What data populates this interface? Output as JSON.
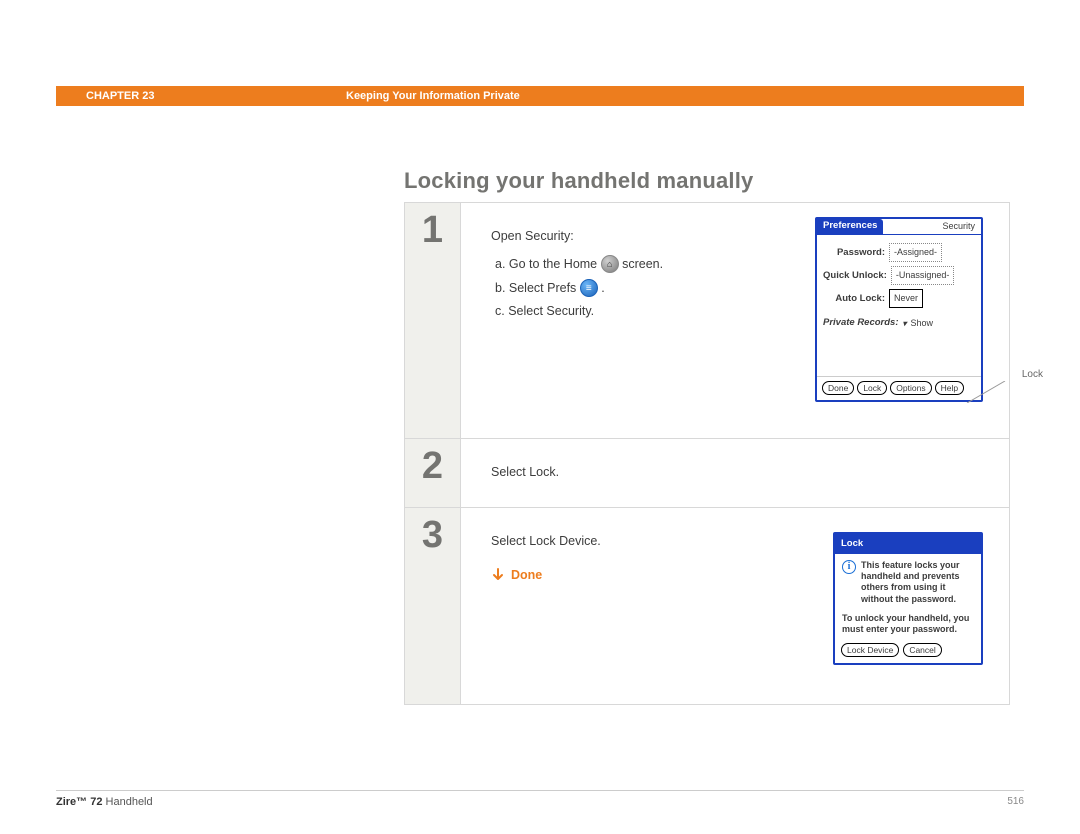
{
  "header": {
    "chapter": "CHAPTER 23",
    "title": "Keeping Your Information Private"
  },
  "page": {
    "heading": "Locking your handheld manually"
  },
  "steps": [
    {
      "num": "1",
      "intro": "Open Security:",
      "sub": {
        "a_prefix": "a.  Go to the Home ",
        "a_suffix": " screen.",
        "b_prefix": "b.  Select Prefs ",
        "b_suffix": ".",
        "c": "c.  Select Security."
      }
    },
    {
      "num": "2",
      "text": "Select Lock."
    },
    {
      "num": "3",
      "text": "Select Lock Device.",
      "done": "Done"
    }
  ],
  "palm1": {
    "title_left": "Preferences",
    "title_right": "Security",
    "rows": {
      "password_label": "Password:",
      "password_value": "-Assigned-",
      "quick_label": "Quick Unlock:",
      "quick_value": "-Unassigned-",
      "auto_label": "Auto Lock:",
      "auto_value": "Never",
      "records_label": "Private Records:",
      "records_value": "Show"
    },
    "buttons": {
      "done": "Done",
      "lock": "Lock",
      "options": "Options",
      "help": "Help"
    },
    "callout": "Lock"
  },
  "palm2": {
    "title": "Lock",
    "msg1": "This feature locks your handheld and prevents others from using it without the password.",
    "msg2": "To unlock your handheld, you must enter your password.",
    "buttons": {
      "lock_device": "Lock Device",
      "cancel": "Cancel"
    }
  },
  "footer": {
    "product_bold": "Zire™ 72",
    "product_rest": " Handheld",
    "page_num": "516"
  }
}
